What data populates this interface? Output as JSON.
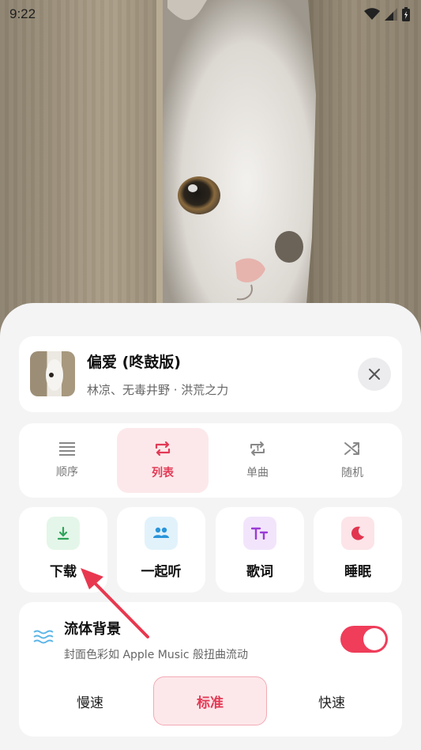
{
  "status_bar": {
    "time": "9:22"
  },
  "now_playing": {
    "title": "偏爱 (咚鼓版)",
    "artist": "林凉、无毒井野 · 洪荒之力"
  },
  "play_modes": [
    {
      "label": "顺序",
      "icon": "list-icon",
      "active": false
    },
    {
      "label": "列表",
      "icon": "repeat-icon",
      "active": true
    },
    {
      "label": "单曲",
      "icon": "repeat-one-icon",
      "active": false
    },
    {
      "label": "随机",
      "icon": "shuffle-icon",
      "active": false
    }
  ],
  "actions": [
    {
      "label": "下载",
      "icon": "download-icon",
      "color": "#2fa45a",
      "bg": "#e4f6e9"
    },
    {
      "label": "一起听",
      "icon": "people-icon",
      "color": "#2a95d9",
      "bg": "#e2f2fb"
    },
    {
      "label": "歌词",
      "icon": "text-size-icon",
      "color": "#9b3bd6",
      "bg": "#f2e5fb"
    },
    {
      "label": "睡眠",
      "icon": "moon-icon",
      "color": "#e2344f",
      "bg": "#fce4e8"
    }
  ],
  "fluid_background": {
    "title": "流体背景",
    "description": "封面色彩如 Apple Music 般扭曲流动",
    "enabled": true,
    "speeds": [
      "慢速",
      "标准",
      "快速"
    ],
    "selected_speed": "标准"
  },
  "colors": {
    "accent": "#ef3d5a",
    "accent_soft": "#fce8ea"
  }
}
